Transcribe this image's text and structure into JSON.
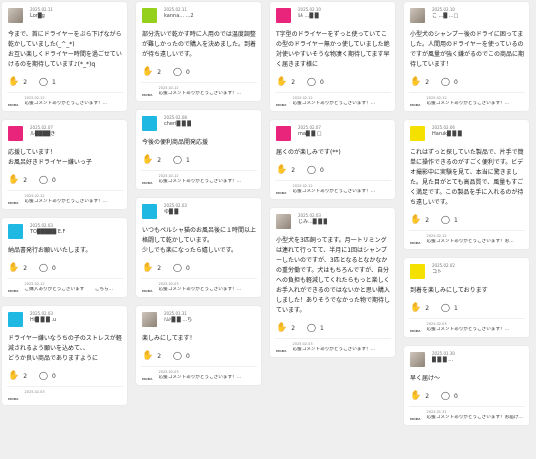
{
  "labels": {
    "brand": "MOBA"
  },
  "colors": {
    "cyan": "#1eb8e2",
    "green": "#95d11c",
    "pink": "#e8257a",
    "yellow": "#f5e100",
    "like": "#f2b418"
  },
  "cards": [
    {
      "id": "c1",
      "avatar": "photo",
      "date": "2025.02.11",
      "user": "Lor█g",
      "body": "今まで、首にドライヤーをぶら下げながら乾かしていました(_^_*)\nお互い楽しくドライヤー時間を過ごせていけるのを期待しています♪(*_*)q",
      "likes": "2",
      "comments": "1",
      "reply_date": "2025.02.12",
      "reply": "応援コメントありがとうございます！..."
    },
    {
      "id": "c2",
      "avatar": "pink",
      "date": "2025.02.07",
      "user": "ル████き",
      "body": "応援しています！\nお風呂好きドライヤー嫌いっ子",
      "likes": "2",
      "comments": "0",
      "reply_date": "2025.02.12",
      "reply": "応援コメントありがとうございます！..."
    },
    {
      "id": "c3",
      "avatar": "cyan",
      "date": "2025.02.03",
      "user": "TO█████ E.F",
      "body": "納品書発行お願いいたします。",
      "likes": "2",
      "comments": "0",
      "reply_date": "2025.02.12",
      "reply": "ご購入ありがとうございます＾＾ こちら..."
    },
    {
      "id": "c4",
      "avatar": "cyan",
      "date": "2025.02.03",
      "user": "Hi█ █ █ .u",
      "body": "ドライヤー嫌いなうちの子のストレスが軽減されるよう願いを込めて、、\nどうか良い商品でありますように",
      "likes": "2",
      "comments": "0",
      "reply_date": "2025.02.03",
      "reply": ""
    },
    {
      "id": "c5",
      "avatar": "green",
      "date": "2025.02.11",
      "user": "kanna... ...2",
      "body": "部分洗いで乾かす時に人用のでは温度調整が難しかったので購入を決めました。到着が待ち遠しいです。",
      "likes": "2",
      "comments": "0",
      "reply_date": "2025.02.12",
      "reply": "応援コメントありがとうございます！..."
    },
    {
      "id": "c6",
      "avatar": "cyan",
      "date": "2025.02.08",
      "user": "cheri█ █ █",
      "body": "今後の便利商品開発応援",
      "likes": "2",
      "comments": "1",
      "reply_date": "2025.02.12",
      "reply": "応援コメントありがとうございます！..."
    },
    {
      "id": "c7",
      "avatar": "cyan",
      "date": "2025.02.03",
      "user": "ゆ█ █",
      "body": "いつもペルシャ猫のお風呂後に１時間以上格闘して乾かしています。\n少しでも楽になったら嬉しいです。",
      "likes": "2",
      "comments": "0",
      "reply_date": "2025.02.03",
      "reply": "応援コメントありがとうございます！..."
    },
    {
      "id": "c8",
      "avatar": "photo",
      "date": "2025.01.31",
      "user": "ﾊﾑﾄ█ █ ...ち",
      "body": "楽しみにしてます！",
      "likes": "2",
      "comments": "0",
      "reply_date": "2025.02.03",
      "reply": "応援コメントありがとうございます！..."
    },
    {
      "id": "c9",
      "avatar": "pink",
      "date": "2025.02.10",
      "user": "ﾙﾙ ...█ █",
      "body": "T字型のドライヤーをずっと使っていてこの型のドライヤー無かっ使していました絶対使いやすいそうな物凄く期待してます早く届きます様に",
      "likes": "2",
      "comments": "0",
      "reply_date": "2025.02.12",
      "reply": "応援コメントありがとうございます！..."
    },
    {
      "id": "c10",
      "avatar": "pink",
      "date": "2025.02.07",
      "user": "ma█ █ □",
      "body": "届くのが楽しみです(**)",
      "likes": "2",
      "comments": "0",
      "reply_date": "2025.02.12",
      "reply": "応援コメントありがとうございます！..."
    },
    {
      "id": "c11",
      "avatar": "photo",
      "date": "2025.02.03",
      "user": "じみ...█ █ █",
      "body": "小型犬を3匹飼ってます。月一トリミングは連れて行ってて、半月に1回はシャンプーしたいのですが、3匹となるとなかなかの重労働です。犬はもちろんですが、自分への負担も軽減してくれたらもっと楽しくお手入れができるのではないかと思い購入しました！ありそうでなかった物で期待しています。",
      "likes": "2",
      "comments": "1",
      "reply_date": "2025.02.03",
      "reply": "応援コメントありがとうございます！..."
    },
    {
      "id": "c12",
      "avatar": "photo",
      "date": "2025.02.10",
      "user": "こ ...█ ...□",
      "body": "小型犬のシャンプー後のドライに困ってました。人間用のドライヤーを使っているのですが風量が強く嫌がるのでこの商品に期待しています！",
      "likes": "2",
      "comments": "0",
      "reply_date": "2025.02.12",
      "reply": "応援コメントありがとうございます！..."
    },
    {
      "id": "c13",
      "avatar": "yellow",
      "date": "2025.02.06",
      "user": "Haruk█ █ █",
      "body": "これはずっと探していた製品で、片手で簡単に操作できるのがすごく便利です。ビデオ撮影中に実験を見て、本当に驚きました。見た目がとても高品質で、風量もすごく満足です。この製品を手に入れるのが待ち遠しいです。",
      "likes": "2",
      "comments": "1",
      "reply_date": "2025.02.12",
      "reply": "応援コメントありがとうございます！お..."
    },
    {
      "id": "c14",
      "avatar": "yellow",
      "date": "2025.02.02",
      "user": "コト",
      "body": "到着を楽しみにしております",
      "likes": "2",
      "comments": "1",
      "reply_date": "2025.02.03",
      "reply": "応援コメントありがとうございます！..."
    },
    {
      "id": "c15",
      "avatar": "photo",
      "date": "2025.01.30",
      "user": "█ █ █ ...",
      "body": "早く届け〜",
      "likes": "2",
      "comments": "0",
      "reply_date": "2025.01.31",
      "reply": "応援コメントありがとうございます！お届け..."
    }
  ]
}
